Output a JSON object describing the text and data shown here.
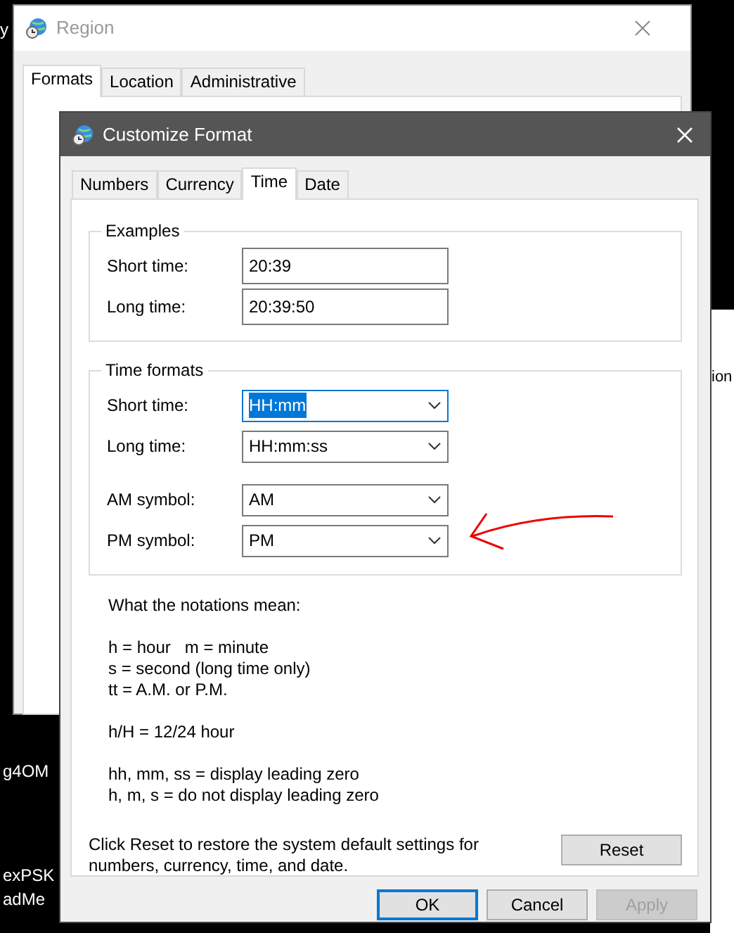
{
  "desktop": {
    "labels": [
      "y",
      "g4OM",
      "exPSK",
      "adMe"
    ]
  },
  "region_window": {
    "title": "Region",
    "tabs": [
      {
        "label": "Formats",
        "selected": true
      },
      {
        "label": "Location",
        "selected": false
      },
      {
        "label": "Administrative",
        "selected": false
      }
    ]
  },
  "background_window": {
    "fragments": [
      "ion"
    ]
  },
  "dialog": {
    "title": "Customize Format",
    "tabs": [
      {
        "label": "Numbers",
        "selected": false
      },
      {
        "label": "Currency",
        "selected": false
      },
      {
        "label": "Time",
        "selected": true
      },
      {
        "label": "Date",
        "selected": false
      }
    ],
    "examples": {
      "title": "Examples",
      "fields": [
        {
          "label": "Short time:",
          "value": "20:39"
        },
        {
          "label": "Long time:",
          "value": "20:39:50"
        }
      ]
    },
    "time_formats": {
      "title": "Time formats",
      "fields": [
        {
          "label": "Short time:",
          "value": "HH:mm",
          "focused": true
        },
        {
          "label": "Long time:",
          "value": "HH:mm:ss",
          "focused": false
        },
        {
          "label": "AM symbol:",
          "value": "AM",
          "focused": false
        },
        {
          "label": "PM symbol:",
          "value": "PM",
          "focused": false
        }
      ]
    },
    "notes": [
      [
        "What the notations mean:"
      ],
      [
        "h = hour   m = minute",
        "s = second (long time only)",
        "tt = A.M. or P.M."
      ],
      [
        "h/H = 12/24 hour"
      ],
      [
        "hh, mm, ss = display leading zero",
        "h, m, s = do not display leading zero"
      ]
    ],
    "reset_text": "Click Reset to restore the system default settings for numbers, currency, time, and date.",
    "reset_button": "Reset",
    "buttons": [
      {
        "label": "OK",
        "default": true,
        "disabled": false
      },
      {
        "label": "Cancel",
        "default": false,
        "disabled": false
      },
      {
        "label": "Apply",
        "default": false,
        "disabled": true
      }
    ]
  },
  "annotation": {
    "kind": "arrow"
  }
}
